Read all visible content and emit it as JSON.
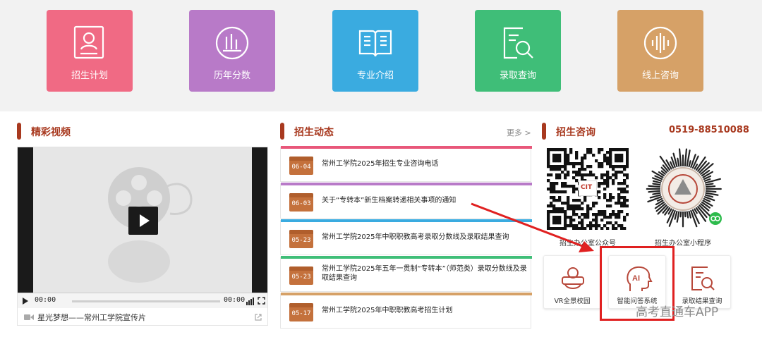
{
  "tiles": [
    {
      "label": "招生计划",
      "color": "#f06a84",
      "icon": "admission-plan-icon"
    },
    {
      "label": "历年分数",
      "color": "#b87ac8",
      "icon": "score-history-icon"
    },
    {
      "label": "专业介绍",
      "color": "#3aabe0",
      "icon": "major-book-icon"
    },
    {
      "label": "录取查询",
      "color": "#3fbe78",
      "icon": "admission-search-icon"
    },
    {
      "label": "线上咨询",
      "color": "#d6a167",
      "icon": "online-voice-icon"
    }
  ],
  "video": {
    "heading": "精彩视频",
    "time_current": "00:00",
    "time_total": "00:00",
    "caption": "星光梦想——常州工学院宣传片"
  },
  "news": {
    "heading": "招生动态",
    "more_label": "更多 >",
    "items": [
      {
        "date": "06-04",
        "title": "常州工学院2025年招生专业咨询电话",
        "accent": "#e8577a"
      },
      {
        "date": "06-03",
        "title": "关于“专转本”新生档案转递相关事项的通知",
        "accent": "#b87ac8"
      },
      {
        "date": "05-23",
        "title": "常州工学院2025年中职职教高考录取分数线及录取结果查询",
        "accent": "#3aabe0"
      },
      {
        "date": "05-23",
        "title": "常州工学院2025年五年一贯制“专转本”（师范类）录取分数线及录取结果查询",
        "accent": "#3fbe78"
      },
      {
        "date": "05-17",
        "title": "常州工学院2025年中职职教高考招生计划",
        "accent": "#d6a167"
      }
    ]
  },
  "consult": {
    "heading": "招生咨询",
    "phone": "0519-88510088",
    "qr_left_label": "招生办公室公众号",
    "qr_right_label": "招生办公室小程序",
    "qr_logo_text": "CIT",
    "services": [
      {
        "label": "VR全景校园",
        "icon": "vr-headset-icon"
      },
      {
        "label": "智能问答系统",
        "icon": "ai-head-icon"
      },
      {
        "label": "录取结果查询",
        "icon": "result-search-icon"
      }
    ]
  },
  "watermark": "高考直通车APP",
  "colors": {
    "accent": "#a8391f",
    "annotation": "#e02020"
  }
}
